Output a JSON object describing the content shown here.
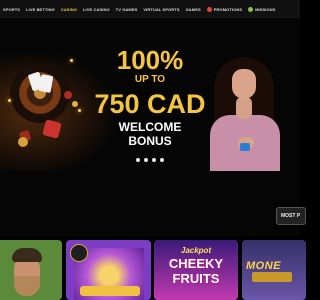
{
  "nav": {
    "items": [
      {
        "label": "SPORTS",
        "active": false
      },
      {
        "label": "LIVE BETTING",
        "active": false
      },
      {
        "label": "CASINO",
        "active": true
      },
      {
        "label": "LIVE CASINO",
        "active": false
      },
      {
        "label": "TV GAMES",
        "active": false
      },
      {
        "label": "VIRTUAL SPORTS",
        "active": false
      },
      {
        "label": "GAMES",
        "active": false
      },
      {
        "label": "PROMOTIONS",
        "active": false,
        "icon": "promotions-icon"
      },
      {
        "label": "MISSIONS",
        "active": false,
        "icon": "missions-icon"
      }
    ]
  },
  "banner": {
    "line1": "100%",
    "line2": "UP TO",
    "line3": "750 CAD",
    "line4": "WELCOME",
    "line5": "BONUS",
    "slides_total": 4,
    "active_slide": 1
  },
  "filter": {
    "label": "MOST P"
  },
  "tiles": [
    {
      "name": "game-tile-1"
    },
    {
      "name": "game-tile-2"
    },
    {
      "name": "game-tile-3",
      "small_label": "Jackpot",
      "title_1": "CHEEKY",
      "title_2": "FRUITS"
    },
    {
      "name": "game-tile-4",
      "title": "MONE"
    }
  ],
  "colors": {
    "accent": "#f4c542",
    "background": "#000000",
    "nav_bg": "#111111"
  }
}
